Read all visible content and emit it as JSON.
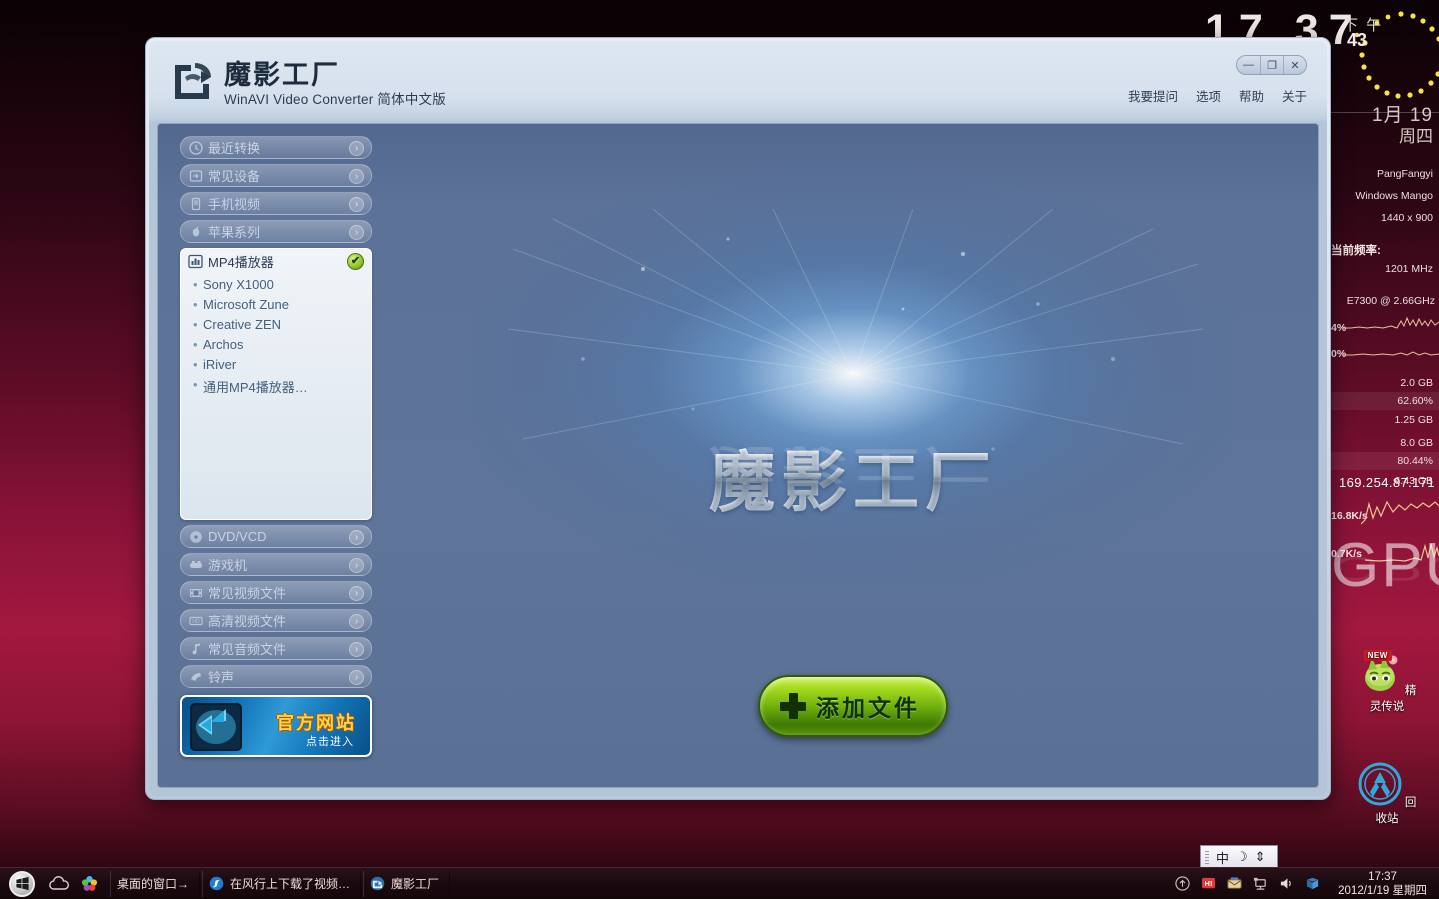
{
  "desktop": {
    "big_clock": "17  37",
    "icons": [
      {
        "label": "精灵传说",
        "badge": "NEW",
        "icon": "game-mascot-icon"
      },
      {
        "label": "回收站",
        "badge": "",
        "icon": "recycle-bin-icon"
      }
    ]
  },
  "gadget": {
    "ampm": "下 午",
    "minutes": "43",
    "date": "1月 19",
    "weekday": "周四",
    "user": "PangFangyi",
    "os": "Windows Mango",
    "resolution": "1440 x 900",
    "freq_label": "当前频率:",
    "freq_value": "1201 MHz",
    "cpu_model": "E7300 @ 2.66GHz",
    "cpu_core1": "4%",
    "cpu_core2": "0%",
    "ram_total": "2.0 GB",
    "ram_percent": "62.60%",
    "ram_used": "1.25 GB",
    "page_total": "8.0 GB",
    "page_percent": "80.44%",
    "page_used": "6.43 GB",
    "net_down": "16.8K/s",
    "net_up": "0.7K/s",
    "ip": "169.254.87.171",
    "gpu_label": "GPU"
  },
  "window": {
    "title": "魔影工厂",
    "subtitle": "WinAVI Video Converter 简体中文版",
    "controls": {
      "minimize": "—",
      "maximize": "❐",
      "close": "✕"
    },
    "menu": [
      "我要提问",
      "选项",
      "帮助",
      "关于"
    ]
  },
  "sidebar": {
    "top_items": [
      {
        "label": "最近转换",
        "icon": "clock-icon"
      },
      {
        "label": "常见设备",
        "icon": "device-icon"
      },
      {
        "label": "手机视频",
        "icon": "phone-icon"
      },
      {
        "label": "苹果系列",
        "icon": "apple-icon"
      }
    ],
    "expanded": {
      "label": "MP4播放器",
      "icon": "mp4-player-icon",
      "check": "✔",
      "items": [
        "Sony X1000",
        "Microsoft Zune",
        "Creative ZEN",
        "Archos",
        "iRiver",
        "通用MP4播放器…"
      ]
    },
    "bottom_items": [
      {
        "label": "DVD/VCD",
        "icon": "disc-icon"
      },
      {
        "label": "游戏机",
        "icon": "gamepad-icon"
      },
      {
        "label": "常见视频文件",
        "icon": "film-icon"
      },
      {
        "label": "高清视频文件",
        "icon": "hd-icon"
      },
      {
        "label": "常见音频文件",
        "icon": "music-note-icon"
      },
      {
        "label": "铃声",
        "icon": "bell-icon"
      }
    ],
    "banner": {
      "title": "官方网站",
      "subtitle": "点击进入"
    }
  },
  "stage": {
    "logo_text": "魔影工厂",
    "add_button": "添加文件"
  },
  "ime": {
    "mode": "中",
    "pen": "☽",
    "tool": "⇕"
  },
  "taskbar": {
    "start": "start-orb",
    "quick_launch": [
      {
        "icon": "cloud-icon",
        "name": "cloud"
      },
      {
        "icon": "colorful-flower-icon",
        "name": "flower"
      }
    ],
    "buttons": [
      {
        "label": "桌面的窗口→",
        "icon": ""
      },
      {
        "label": "在风行上下载了视频…",
        "icon": "funshion-icon"
      },
      {
        "label": "魔影工厂",
        "icon": "winavi-icon"
      }
    ],
    "tray_icons": [
      "show-hidden-icon",
      "hi-icon",
      "mail-icon",
      "network-icon",
      "volume-icon",
      "store-icon"
    ],
    "clock_time": "17:37",
    "clock_date": "2012/1/19  星期四"
  }
}
